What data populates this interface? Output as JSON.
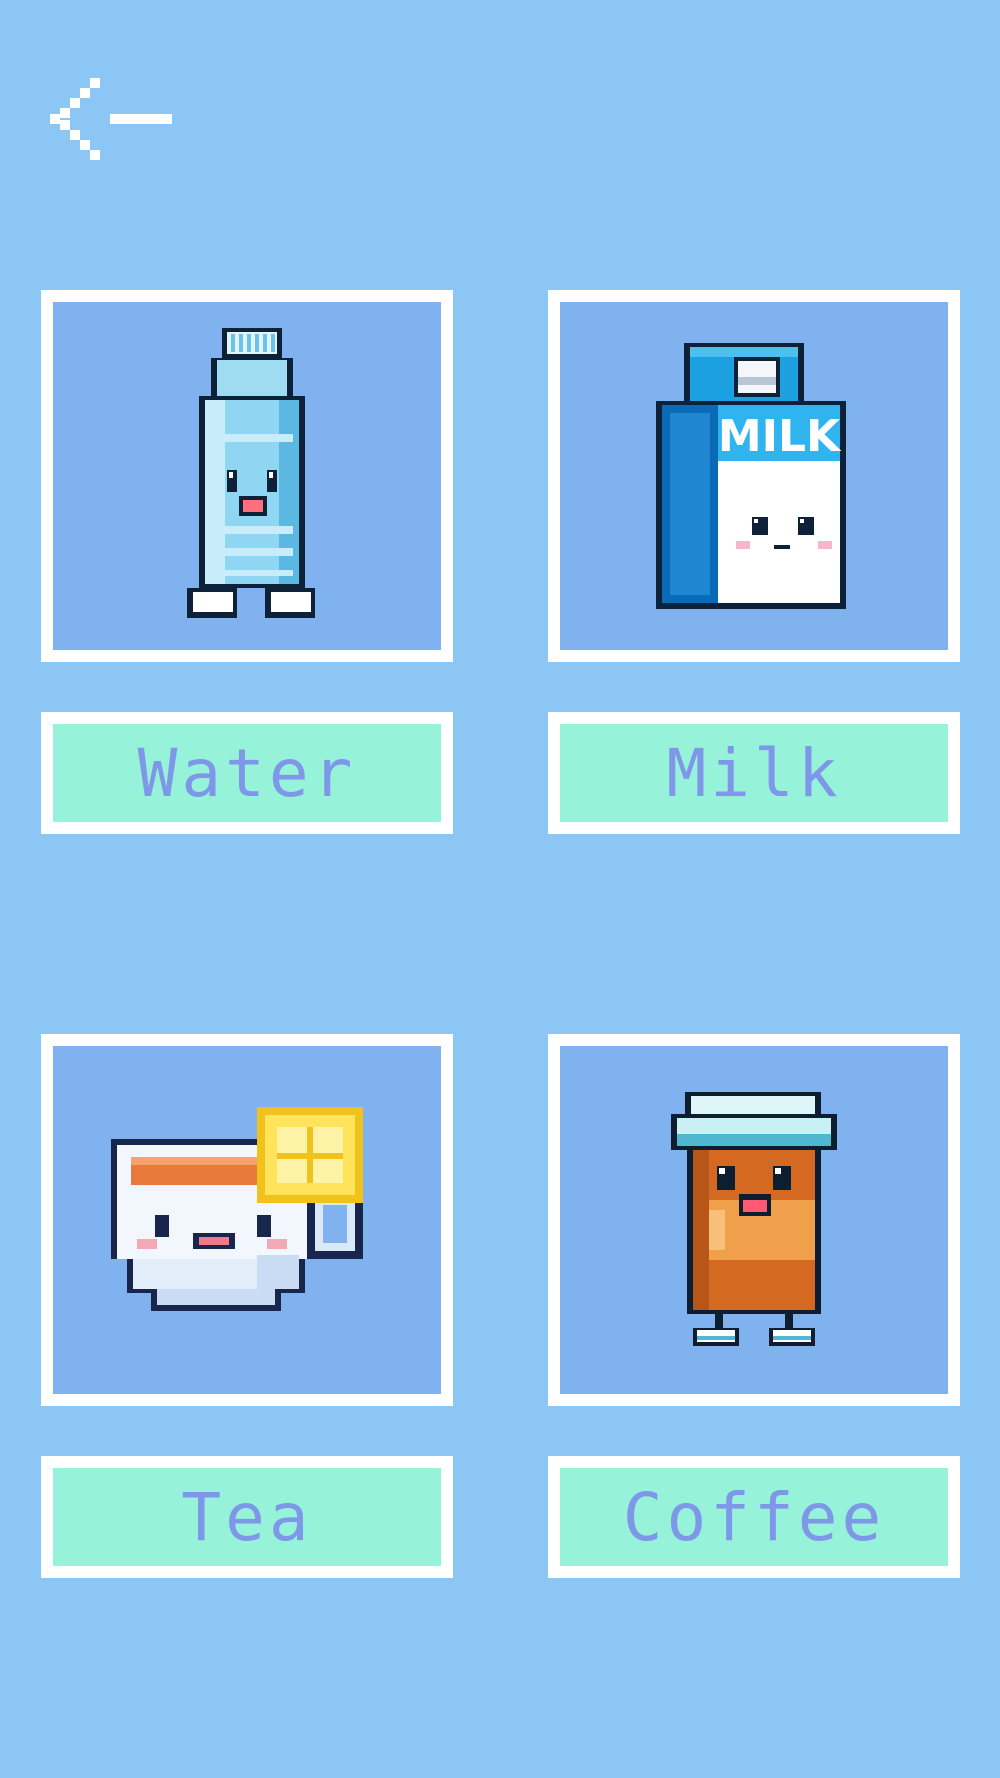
{
  "nav": {
    "back_icon": "pixel-arrow-left-icon"
  },
  "colors": {
    "background": "#8cc6f4",
    "card_fill": "#80b2f0",
    "card_border": "#ffffff",
    "label_fill": "#96f2d8",
    "label_text": "#7f97e8"
  },
  "drinks": [
    {
      "id": "water",
      "label": "Water",
      "icon": "water-bottle-icon"
    },
    {
      "id": "milk",
      "label": "Milk",
      "icon": "milk-carton-icon",
      "carton_text": "MILK"
    },
    {
      "id": "tea",
      "label": "Tea",
      "icon": "tea-cup-icon"
    },
    {
      "id": "coffee",
      "label": "Coffee",
      "icon": "coffee-cup-icon"
    }
  ]
}
